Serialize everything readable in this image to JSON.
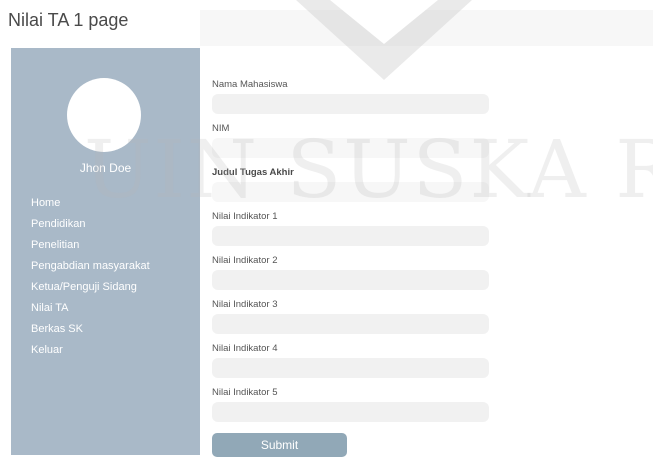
{
  "page": {
    "title": "Nilai TA 1 page"
  },
  "watermark": {
    "text": "UIN SUSKA RIA"
  },
  "sidebar": {
    "user_name": "Jhon Doe",
    "items": [
      {
        "label": "Home"
      },
      {
        "label": "Pendidikan"
      },
      {
        "label": "Penelitian"
      },
      {
        "label": "Pengabdian masyarakat"
      },
      {
        "label": "Ketua/Penguji Sidang"
      },
      {
        "label": "Nilai TA"
      },
      {
        "label": "Berkas SK"
      },
      {
        "label": "Keluar"
      }
    ]
  },
  "form": {
    "fields": [
      {
        "label": "Nama Mahasiswa",
        "value": ""
      },
      {
        "label": "NIM",
        "value": ""
      },
      {
        "label": "Judul Tugas Akhir",
        "value": ""
      },
      {
        "label": "Nilai Indikator 1",
        "value": ""
      },
      {
        "label": "Nilai Indikator 2",
        "value": ""
      },
      {
        "label": "Nilai Indikator 3",
        "value": ""
      },
      {
        "label": "Nilai Indikator 4",
        "value": ""
      },
      {
        "label": "Nilai Indikator 5",
        "value": ""
      }
    ],
    "submit_label": "Submit"
  },
  "colors": {
    "sidebar_bg": "#a9b9c8",
    "button_bg": "#91a8b7",
    "input_bg": "#f1f1f1"
  }
}
